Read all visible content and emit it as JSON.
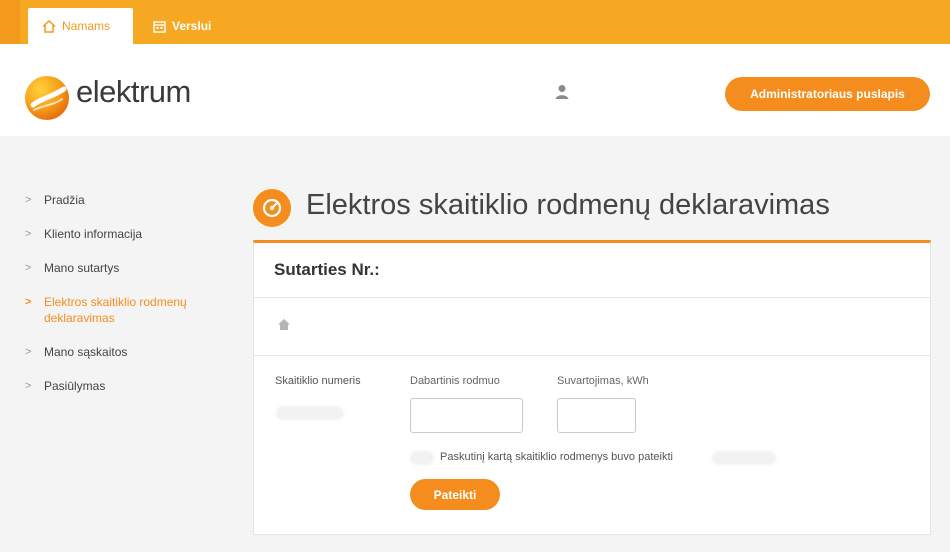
{
  "tabs": {
    "home": "Namams",
    "business": "Verslui"
  },
  "header": {
    "brand": "elektrum",
    "admin_button": "Administratoriaus puslapis"
  },
  "sidebar": {
    "items": [
      {
        "label": "Pradžia",
        "active": false
      },
      {
        "label": "Kliento informacija",
        "active": false
      },
      {
        "label": "Mano sutartys",
        "active": false
      },
      {
        "label": "Elektros skaitiklio rodmenų deklaravimas",
        "active": true
      },
      {
        "label": "Mano sąskaitos",
        "active": false
      },
      {
        "label": "Pasiūlymas",
        "active": false
      }
    ]
  },
  "main": {
    "title": "Elektros skaitiklio rodmenų deklaravimas",
    "contract_label": "Sutarties Nr.:",
    "meter_label": "Skaitiklio numeris",
    "current_label": "Dabartinis rodmuo",
    "usage_label": "Suvartojimas, kWh",
    "current_value": "",
    "usage_value": "",
    "last_note": "Paskutinį kartą skaitiklio rodmenys buvo pateikti",
    "submit_label": "Pateikti"
  },
  "colors": {
    "accent": "#f58d1e",
    "topbar": "#f7a823"
  },
  "icons": [
    "home-icon",
    "calendar-icon",
    "user-icon",
    "gauge-icon",
    "chevron-right-icon"
  ]
}
